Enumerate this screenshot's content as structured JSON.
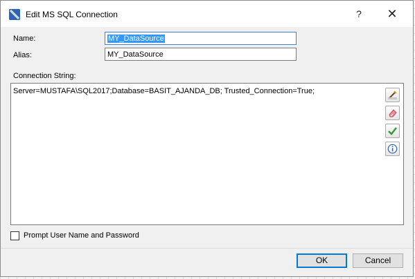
{
  "window": {
    "title": "Edit MS SQL Connection",
    "help_label": "?",
    "close_label": "✕"
  },
  "form": {
    "name_label": "Name:",
    "name_value": "MY_DataSource",
    "alias_label": "Alias:",
    "alias_value": "MY_DataSource",
    "connection_string_label": "Connection String:",
    "connection_string_value": "Server=MUSTAFA\\SQL2017;Database=BASIT_AJANDA_DB; Trusted_Connection=True;"
  },
  "side_buttons": [
    {
      "icon": "edit-wizard-icon"
    },
    {
      "icon": "eraser-icon"
    },
    {
      "icon": "checkmark-icon"
    },
    {
      "icon": "info-icon"
    }
  ],
  "prompt": {
    "checkbox_label": "Prompt User Name and Password",
    "checked": false
  },
  "footer": {
    "ok_label": "OK",
    "cancel_label": "Cancel"
  },
  "colors": {
    "selection": "#3399ff",
    "focus_border": "#3b83d8",
    "default_button_border": "#0078d7"
  }
}
